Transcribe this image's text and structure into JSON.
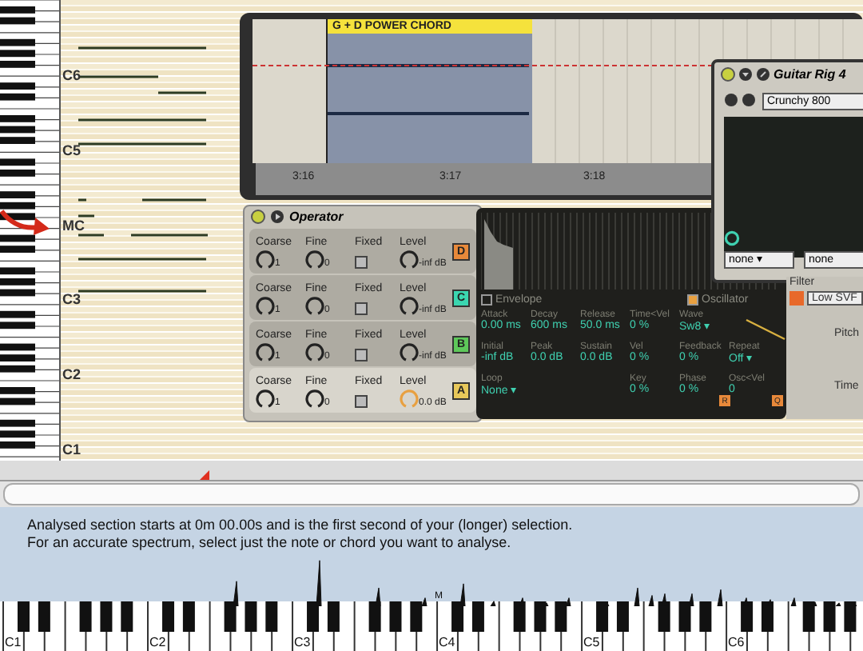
{
  "piano_roll": {
    "octave_labels": [
      "C6",
      "C5",
      "MC",
      "C3",
      "C2",
      "C1"
    ]
  },
  "arrangement": {
    "clip": "G + D POWER CHORD",
    "ticks": [
      "3:16",
      "3:17",
      "3:18"
    ]
  },
  "operator": {
    "title": "Operator",
    "rows": [
      {
        "letter": "D",
        "color": "#e8893a",
        "selected": false,
        "coarse_label": "Coarse",
        "coarse": "1",
        "fine_label": "Fine",
        "fine": "0",
        "fixed_label": "Fixed",
        "fixed": false,
        "level_label": "Level",
        "level_value": "-inf dB"
      },
      {
        "letter": "C",
        "color": "#3bd6b0",
        "selected": false,
        "coarse_label": "Coarse",
        "coarse": "1",
        "fine_label": "Fine",
        "fine": "0",
        "fixed_label": "Fixed",
        "fixed": false,
        "level_label": "Level",
        "level_value": "-inf dB"
      },
      {
        "letter": "B",
        "color": "#5ec85a",
        "selected": false,
        "coarse_label": "Coarse",
        "coarse": "1",
        "fine_label": "Fine",
        "fine": "0",
        "fixed_label": "Fixed",
        "fixed": false,
        "level_label": "Level",
        "level_value": "-inf dB"
      },
      {
        "letter": "A",
        "color": "#e8c85a",
        "selected": true,
        "coarse_label": "Coarse",
        "coarse": "1",
        "fine_label": "Fine",
        "fine": "0",
        "fixed_label": "Fixed",
        "fixed": false,
        "level_label": "Level",
        "level_value": "0.0 dB"
      }
    ]
  },
  "envelope": {
    "envelope_label": "Envelope",
    "envelope_on": false,
    "oscillator_label": "Oscillator",
    "oscillator_on": true,
    "params": [
      {
        "label": "Attack",
        "value": "0.00 ms"
      },
      {
        "label": "Decay",
        "value": "600 ms"
      },
      {
        "label": "Release",
        "value": "50.0 ms"
      },
      {
        "label": "Time<Vel",
        "value": "0 %"
      },
      {
        "label": "Wave",
        "value": "Sw8 ▾"
      },
      {
        "kind": "blank"
      },
      {
        "label": "Initial",
        "value": "-inf dB"
      },
      {
        "label": "Peak",
        "value": "0.0 dB"
      },
      {
        "label": "Sustain",
        "value": "0.0 dB"
      },
      {
        "label": "Vel",
        "value": "0 %"
      },
      {
        "label": "Feedback",
        "value": "0 %"
      },
      {
        "label": "Repeat",
        "value": "Off ▾"
      },
      {
        "label": "Loop",
        "value": "None ▾"
      },
      {
        "kind": "blank"
      },
      {
        "kind": "blank"
      },
      {
        "label": "Key",
        "value": "0 %"
      },
      {
        "label": "Phase",
        "value": "0 %"
      },
      {
        "label": "Osc<Vel",
        "value": "0"
      }
    ],
    "buttons": [
      "R",
      "Q"
    ]
  },
  "guitar_rig": {
    "title": "Guitar Rig 4",
    "preset": "Crunchy 800",
    "dropdowns": [
      "none ▾",
      "none"
    ]
  },
  "side_panel": {
    "filter_label": "Filter",
    "filter_type": "Low SVF",
    "pitch_label": "Pitch",
    "time_label": "Time"
  },
  "spectrum": {
    "lines": [
      "Analysed section starts at 0m 00.00s and is the first second of your (longer) selection.",
      "For an accurate spectrum, select just the note or chord you want to analyse."
    ],
    "key_labels": [
      "C1",
      "C2",
      "C3",
      "C4",
      "C5",
      "C6"
    ],
    "marker": "M"
  }
}
